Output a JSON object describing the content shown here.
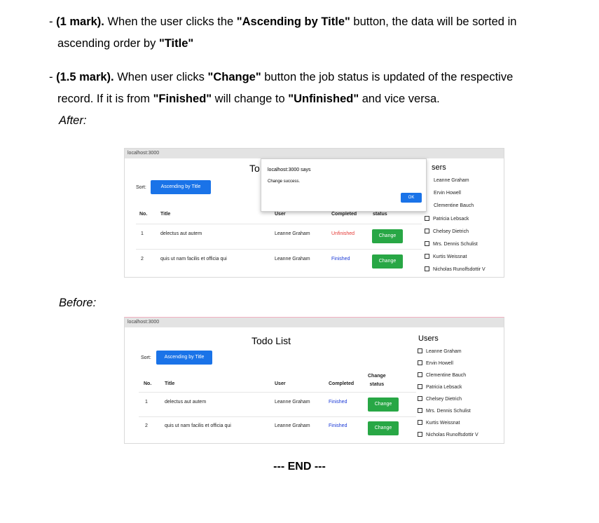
{
  "doc": {
    "req1": {
      "dash": "- ",
      "mark": "(1 mark).",
      "t1": " When the user clicks the ",
      "q1": "\"Ascending by Title\"",
      "t2": " button, the data will be sorted in",
      "line2a": "ascending order by ",
      "q2": "\"Title\""
    },
    "req2": {
      "dash": "- ",
      "mark": "(1.5 mark).",
      "t1": " When user clicks ",
      "q1": "\"Change\"",
      "t2": " button the job status is updated of the respective",
      "line2a": "record. If it is from ",
      "q2": "\"Finished\"",
      "t3": " will change to ",
      "q3": "\"Unfinished\"",
      "t4": " and vice versa."
    },
    "after_label": "After:",
    "before_label": "Before:",
    "end": "--- END ---"
  },
  "after": {
    "address": "localhost:3000",
    "title_partial": "To",
    "users_header_partial": "sers",
    "sort_label": "Sort:",
    "sort_button": "Ascending by Title",
    "columns": [
      "No.",
      "Title",
      "User",
      "Completed",
      "status"
    ],
    "rows": [
      {
        "no": "1",
        "title": "delectus aut autem",
        "user": "Leanne Graham",
        "completed": "Unfinished",
        "action": "Change"
      },
      {
        "no": "2",
        "title": "quis ut nam facilis et officia qui",
        "user": "Leanne Graham",
        "completed": "Finished",
        "action": "Change"
      }
    ],
    "dialog": {
      "title": "localhost:3000 says",
      "message": "Change success.",
      "ok": "OK"
    },
    "users": [
      "Leanne Graham",
      "Ervin Howell",
      "Clementine Bauch",
      "Patricia Lebsack",
      "Chelsey Dietrich",
      "Mrs. Dennis Schulist",
      "Kurtis Weissnat",
      "Nicholas Runolfsdottir V"
    ]
  },
  "before": {
    "address": "localhost:3000",
    "title": "Todo List",
    "users_header": "Users",
    "sort_label": "Sort:",
    "sort_button": "Ascending by Title",
    "columns": [
      "No.",
      "Title",
      "User",
      "Completed",
      "Change status"
    ],
    "change_col_top": "Change",
    "change_col_bottom": "status",
    "rows": [
      {
        "no": "1",
        "title": "delectus aut autem",
        "user": "Leanne Graham",
        "completed": "Finished",
        "action": "Change"
      },
      {
        "no": "2",
        "title": "quis ut nam facilis et officia qui",
        "user": "Leanne Graham",
        "completed": "Finished",
        "action": "Change"
      }
    ],
    "users": [
      "Leanne Graham",
      "Ervin Howell",
      "Clementine Bauch",
      "Patricia Lebsack",
      "Chelsey Dietrich",
      "Mrs. Dennis Schulist",
      "Kurtis Weissnat",
      "Nicholas Runolfsdottir V"
    ]
  },
  "colors": {
    "blue_button": "#1a73e8",
    "green_button": "#28a745",
    "unfinished": "#e53935",
    "finished": "#1a39d6"
  }
}
